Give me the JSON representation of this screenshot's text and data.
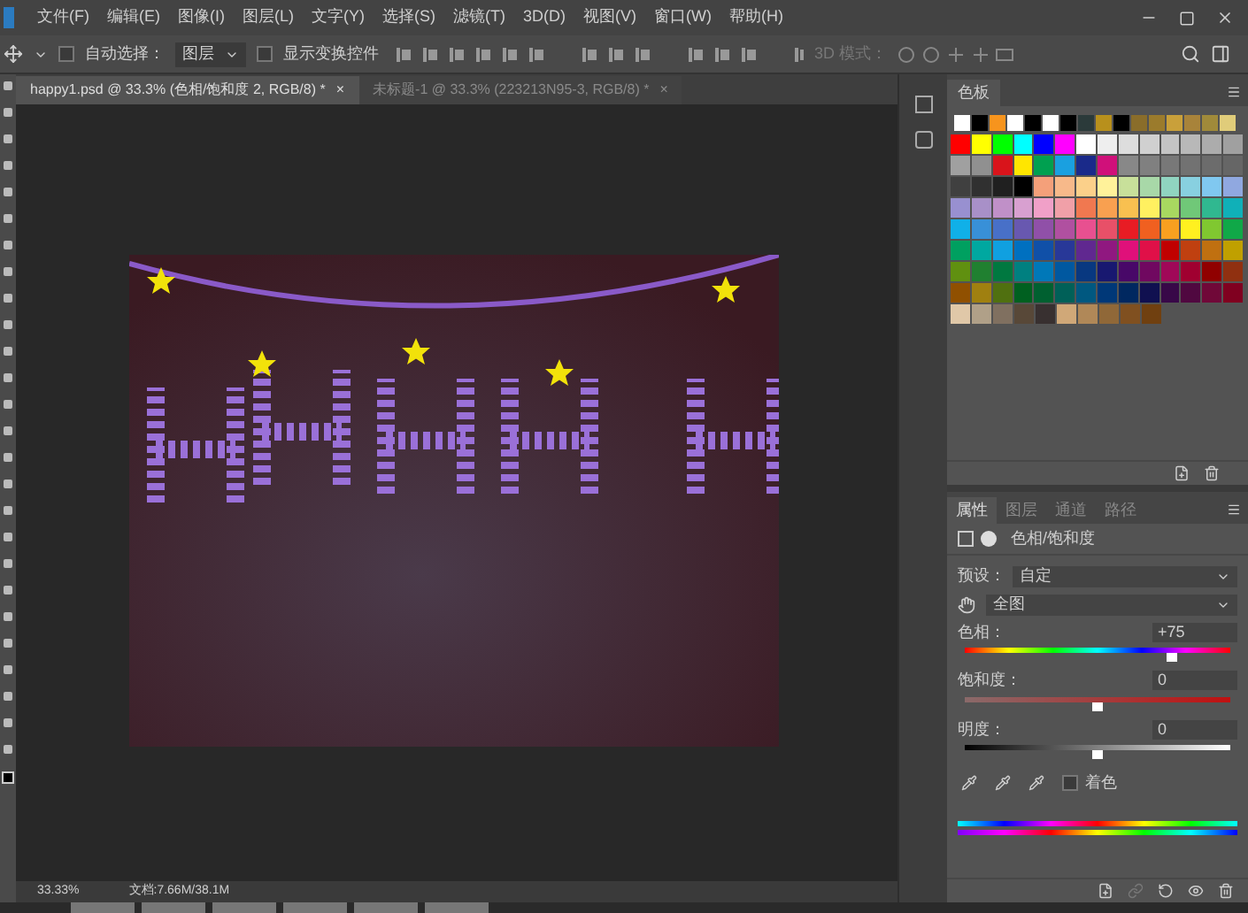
{
  "menu": [
    "文件(F)",
    "编辑(E)",
    "图像(I)",
    "图层(L)",
    "文字(Y)",
    "选择(S)",
    "滤镜(T)",
    "3D(D)",
    "视图(V)",
    "窗口(W)",
    "帮助(H)"
  ],
  "options": {
    "auto_select_label": "自动选择：",
    "auto_select": {
      "checked": false
    },
    "target": "图层",
    "show_transform": {
      "label": "显示变换控件",
      "checked": false
    },
    "mode_3d": "3D 模式："
  },
  "doc_tabs": [
    {
      "label": "happy1.psd @ 33.3% (色相/饱和度 2, RGB/8) *",
      "selected": true,
      "close": "×"
    },
    {
      "label": "未标题-1 @ 33.3% (223213N95-3, RGB/8) *",
      "selected": false,
      "close": "×"
    }
  ],
  "status_bar": {
    "zoom": "33.33%",
    "doc": "文档:7.66M/38.1M"
  },
  "swatches_panel": {
    "tab": "色板",
    "top_row": [
      {
        "color": "#ffffff"
      },
      {
        "color": "#000000"
      },
      {
        "color": "#f7941d"
      },
      {
        "color": "#ffffff"
      },
      {
        "color": "#000000"
      },
      {
        "color": "#ffffff"
      },
      {
        "color": "#000000"
      },
      {
        "color": "#2b3a3a"
      },
      {
        "color": "#b8901c"
      },
      {
        "color": "#000000"
      },
      {
        "color": "#8a6d2a"
      },
      {
        "color": "#9b7b2c"
      },
      {
        "color": "#c9a03a"
      },
      {
        "color": "#a8833a"
      },
      {
        "color": "#a08a3a"
      },
      {
        "color": "#e0cc7a"
      }
    ],
    "rows": [
      [
        {
          "color": "#ff0000"
        },
        {
          "color": "#ffff00"
        },
        {
          "color": "#00ff00"
        },
        {
          "color": "#00ffff"
        },
        {
          "color": "#0000ff"
        },
        {
          "color": "#ff00ff"
        },
        {
          "color": "#ffffff"
        },
        {
          "color": "#eeeeee"
        },
        {
          "color": "#dddddd"
        },
        {
          "color": "#d0d0d0"
        },
        {
          "color": "#c4c4c4"
        },
        {
          "color": "#b8b8b8"
        },
        {
          "color": "#acacac"
        },
        {
          "color": "#a0a0a0"
        }
      ],
      [
        {
          "color": "#a0a0a0"
        },
        {
          "color": "#909090"
        },
        {
          "color": "#d9141b"
        },
        {
          "color": "#ffe600"
        },
        {
          "color": "#00a050"
        },
        {
          "color": "#1aa0e0"
        },
        {
          "color": "#1a2a8a"
        },
        {
          "color": "#d0107a"
        },
        {
          "color": "#888888"
        },
        {
          "color": "#808080"
        },
        {
          "color": "#787878"
        },
        {
          "color": "#727272"
        },
        {
          "color": "#6c6c6c"
        },
        {
          "color": "#666666"
        }
      ],
      [
        {
          "color": "#404040"
        },
        {
          "color": "#303030"
        },
        {
          "color": "#202020"
        },
        {
          "color": "#000000"
        },
        {
          "color": "#f4a07a"
        },
        {
          "color": "#f7b98a"
        },
        {
          "color": "#fbd08a"
        },
        {
          "color": "#fff29a"
        },
        {
          "color": "#c8e09a"
        },
        {
          "color": "#a8d8a8"
        },
        {
          "color": "#90d4c0"
        },
        {
          "color": "#88d0e0"
        },
        {
          "color": "#80c8f0"
        },
        {
          "color": "#90a8e0"
        }
      ],
      [
        {
          "color": "#9890d0"
        },
        {
          "color": "#a890c8"
        },
        {
          "color": "#c090c8"
        },
        {
          "color": "#d8a0d0"
        },
        {
          "color": "#f0a0c8"
        },
        {
          "color": "#f0a0a8"
        },
        {
          "color": "#f07850"
        },
        {
          "color": "#f8a050"
        },
        {
          "color": "#f8c050"
        },
        {
          "color": "#fff060"
        },
        {
          "color": "#a8d860"
        },
        {
          "color": "#70c878"
        },
        {
          "color": "#30b890"
        },
        {
          "color": "#10b0b8"
        }
      ],
      [
        {
          "color": "#10b0e8"
        },
        {
          "color": "#3890d8"
        },
        {
          "color": "#4870c8"
        },
        {
          "color": "#6858b0"
        },
        {
          "color": "#9050a8"
        },
        {
          "color": "#b050a0"
        },
        {
          "color": "#e85090"
        },
        {
          "color": "#e85068"
        },
        {
          "color": "#e81c24"
        },
        {
          "color": "#f06020"
        },
        {
          "color": "#f8a020"
        },
        {
          "color": "#fff020"
        },
        {
          "color": "#80c830"
        },
        {
          "color": "#10a848"
        }
      ],
      [
        {
          "color": "#00a060"
        },
        {
          "color": "#00a8a0"
        },
        {
          "color": "#10a0e0"
        },
        {
          "color": "#0070c0"
        },
        {
          "color": "#1050a8"
        },
        {
          "color": "#283898"
        },
        {
          "color": "#602890"
        },
        {
          "color": "#901880"
        },
        {
          "color": "#e0107a"
        },
        {
          "color": "#e01048"
        },
        {
          "color": "#c00000"
        },
        {
          "color": "#c04010"
        },
        {
          "color": "#c07010"
        },
        {
          "color": "#c0a000"
        }
      ],
      [
        {
          "color": "#609010"
        },
        {
          "color": "#208030"
        },
        {
          "color": "#007840"
        },
        {
          "color": "#008080"
        },
        {
          "color": "#0078b8"
        },
        {
          "color": "#0058a0"
        },
        {
          "color": "#083880"
        },
        {
          "color": "#181870"
        },
        {
          "color": "#480868"
        },
        {
          "color": "#700860"
        },
        {
          "color": "#a00858"
        },
        {
          "color": "#a00030"
        },
        {
          "color": "#900000"
        },
        {
          "color": "#903010"
        }
      ],
      [
        {
          "color": "#905000"
        },
        {
          "color": "#a08010"
        },
        {
          "color": "#507010"
        },
        {
          "color": "#006020"
        },
        {
          "color": "#006030"
        },
        {
          "color": "#006058"
        },
        {
          "color": "#005880"
        },
        {
          "color": "#003878"
        },
        {
          "color": "#002860"
        },
        {
          "color": "#101050"
        },
        {
          "color": "#380848"
        },
        {
          "color": "#500840"
        },
        {
          "color": "#700838"
        },
        {
          "color": "#800020"
        }
      ],
      [
        {
          "color": "#e0c8a8"
        },
        {
          "color": "#b0a088"
        },
        {
          "color": "#807060"
        },
        {
          "color": "#584838"
        },
        {
          "color": "#383030"
        },
        {
          "color": "#d0a878"
        },
        {
          "color": "#b08858"
        },
        {
          "color": "#906838"
        },
        {
          "color": "#805020"
        },
        {
          "color": "#704010"
        }
      ]
    ]
  },
  "properties_panel": {
    "tabs": [
      {
        "label": "属性",
        "selected": true
      },
      {
        "label": "图层",
        "selected": false
      },
      {
        "label": "通道",
        "selected": false
      },
      {
        "label": "路径",
        "selected": false
      }
    ],
    "title": "色相/饱和度",
    "preset_label": "预设：",
    "preset": "自定",
    "range": "全图",
    "sliders": [
      {
        "kind": "hue",
        "label": "色相：",
        "value": "+75",
        "level": 0.78
      },
      {
        "kind": "saturation",
        "label": "饱和度：",
        "value": "0",
        "level": 0.5
      },
      {
        "kind": "lightness",
        "label": "明度：",
        "value": "0",
        "level": 0.5
      }
    ],
    "colorize": {
      "label": "着色",
      "checked": false
    }
  }
}
